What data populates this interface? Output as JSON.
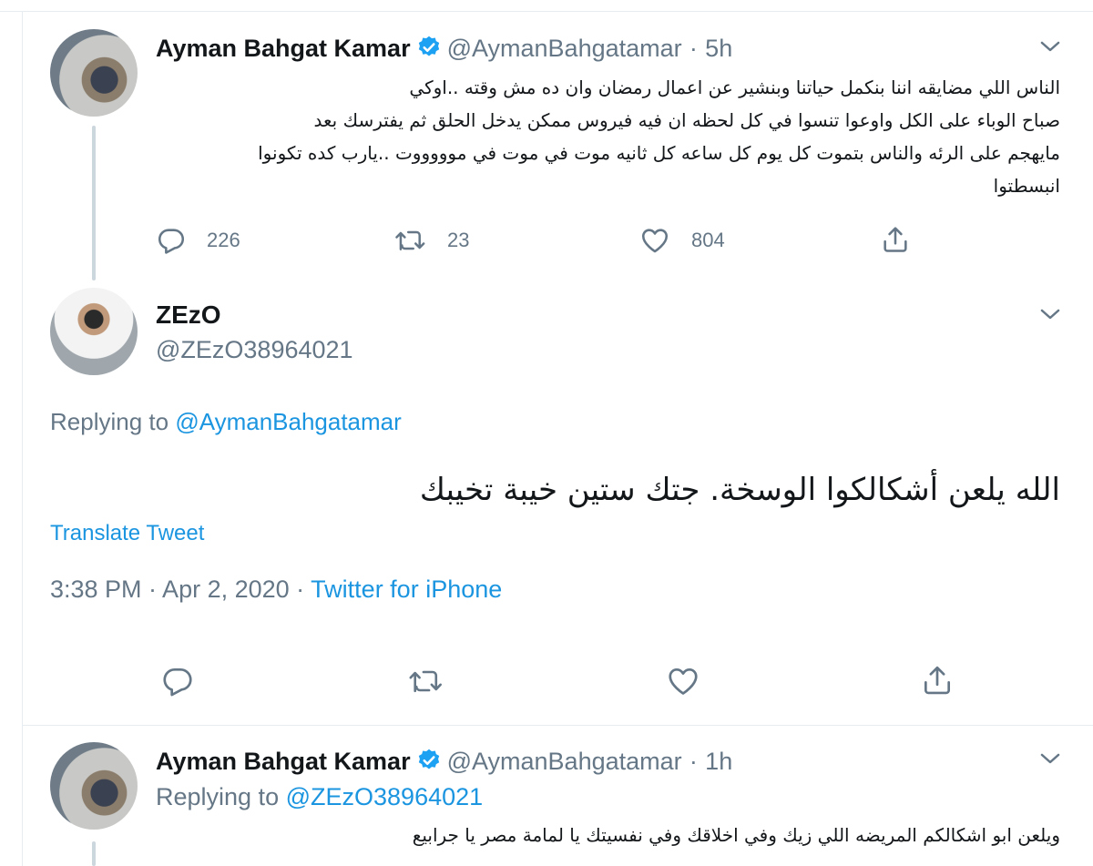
{
  "tweet1": {
    "name": "Ayman Bahgat Kamar",
    "handle": "@AymanBahgatamar",
    "separator": "·",
    "time": "5h",
    "text_lines": [
      "الناس اللي مضايقه اننا بنكمل حياتنا وبنشير عن اعمال رمضان وان ده مش وقته ..اوكي",
      "صباح الوباء على الكل واوعوا تنسوا في كل لحظه ان فيه فيروس ممكن يدخل الحلق ثم يفترسك بعد",
      "مايهجم على الرئه والناس بتموت كل يوم كل ساعه كل ثانيه موت في موت في موووووت ..يارب كده تكونوا",
      "انبسطتوا"
    ],
    "reply_count": "226",
    "retweet_count": "23",
    "like_count": "804"
  },
  "tweet2": {
    "name": "ZEzO",
    "handle": "@ZEzO38964021",
    "replying_prefix": "Replying to",
    "replying_to": "@AymanBahgatamar",
    "text": "الله يلعن أشكالكوا الوسخة. جتك ستين خيبة تخيبك",
    "translate": "Translate Tweet",
    "timestamp": "3:38 PM · Apr 2, 2020 · ",
    "source": "Twitter for iPhone"
  },
  "tweet3": {
    "name": "Ayman Bahgat Kamar",
    "handle": "@AymanBahgatamar",
    "separator": "·",
    "time": "1h",
    "replying_prefix": "Replying to",
    "replying_to": "@ZEzO38964021",
    "text": "ويلعن ابو اشكالكم المريضه  اللي زيك وفي اخلاقك وفي نفسيتك يا لمامة مصر يا جرابيع"
  },
  "icons": {
    "reply": "reply-icon",
    "retweet": "retweet-icon",
    "like": "heart-icon",
    "share": "share-icon",
    "more": "chevron-down-icon",
    "verified": "verified-badge-icon"
  },
  "colors": {
    "link": "#1b95e0",
    "muted": "#657786",
    "text": "#14171a",
    "divider": "#e6ecf0",
    "thread_line": "#ccd6dd"
  }
}
